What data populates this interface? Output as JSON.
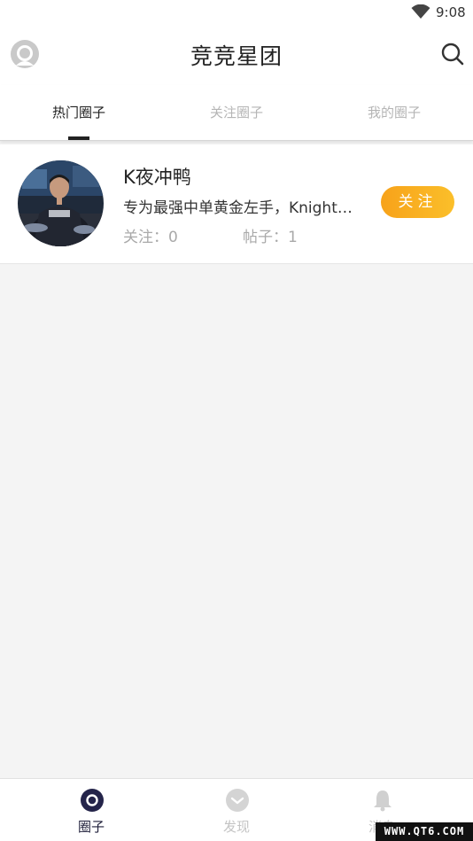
{
  "status_bar": {
    "time": "9:08",
    "wifi_icon": "wifi-icon"
  },
  "app_bar": {
    "title": "竞竞星团",
    "left_icon": "user-avatar-icon",
    "right_icon": "search-icon"
  },
  "tabs": [
    {
      "label": "热门圈子",
      "active": true
    },
    {
      "label": "关注圈子",
      "active": false
    },
    {
      "label": "我的圈子",
      "active": false
    }
  ],
  "circles": [
    {
      "name": "K夜冲鸭",
      "description": "专为最强中单黄金左手，Knight…",
      "follow_label": "关注",
      "stats": {
        "follow": "关注：0",
        "posts": "帖子：1"
      }
    }
  ],
  "bottom_nav": [
    {
      "label": "圈子",
      "icon": "circle-icon",
      "active": true
    },
    {
      "label": "发现",
      "icon": "discover-icon",
      "active": false
    },
    {
      "label": "消息",
      "icon": "bell-icon",
      "active": false
    }
  ],
  "watermark": "WWW.QT6.COM",
  "colors": {
    "accent": "#f7a21a",
    "active_nav": "#1f1f3a",
    "inactive": "#c4c4c4"
  }
}
